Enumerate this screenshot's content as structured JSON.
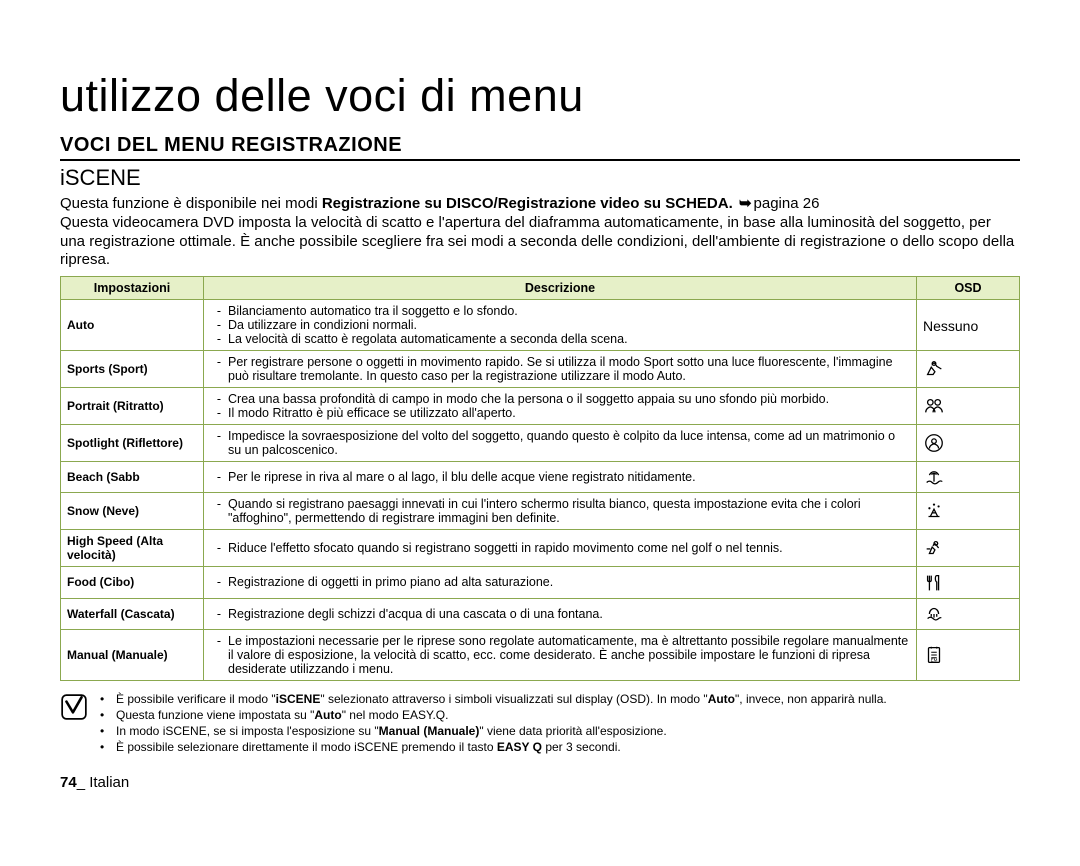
{
  "page": {
    "title": "utilizzo delle voci di menu",
    "section_title": "VOCI DEL MENU REGISTRAZIONE",
    "subheading": "iSCENE",
    "intro_pre": "Questa funzione è disponibile nei modi ",
    "intro_bold": "Registrazione su DISCO/Registrazione video su SCHEDA.",
    "intro_pageref": "pagina 26",
    "intro_body": "Questa videocamera DVD imposta la velocità di scatto e l'apertura del diaframma automaticamente, in base alla luminosità del soggetto, per una registrazione ottimale. È anche possibile scegliere fra sei modi a seconda delle condizioni, dell'ambiente di registrazione o dello scopo della ripresa."
  },
  "table": {
    "headers": {
      "impostazioni": "Impostazioni",
      "descrizione": "Descrizione",
      "osd": "OSD"
    },
    "rows": [
      {
        "setting": "Auto",
        "osd_text": "Nessuno",
        "desc": [
          "Bilanciamento automatico tra il soggetto e lo sfondo.",
          "Da utilizzare in condizioni normali.",
          "La velocità di scatto è regolata automaticamente a seconda della scena."
        ]
      },
      {
        "setting": "Sports (Sport)",
        "osd_icon": "sports",
        "desc": [
          "Per registrare persone o oggetti in movimento rapido. Se si utilizza il modo Sport sotto una luce fluorescente, l'immagine può risultare tremolante. In questo caso per la registrazione utilizzare il modo Auto."
        ]
      },
      {
        "setting": "Portrait (Ritratto)",
        "osd_icon": "portrait",
        "desc": [
          "Crea una bassa profondità di campo in modo che la persona o il soggetto appaia su uno sfondo più morbido.",
          "Il modo Ritratto è più efficace se utilizzato all'aperto."
        ]
      },
      {
        "setting": "Spotlight (Riflettore)",
        "osd_icon": "spotlight",
        "desc": [
          "Impedisce la sovraesposizione del volto del soggetto, quando questo è colpito da luce intensa, come ad un matrimonio o su un palcoscenico."
        ]
      },
      {
        "setting": "Beach (Sabb",
        "osd_icon": "beach",
        "desc": [
          "Per le riprese in riva al mare o al lago, il blu delle acque viene registrato nitidamente."
        ]
      },
      {
        "setting": "Snow (Neve)",
        "osd_icon": "snow",
        "desc": [
          "Quando si registrano paesaggi innevati in cui l'intero schermo risulta bianco, questa impostazione evita che i colori \"affoghino\", permettendo di registrare immagini ben definite."
        ]
      },
      {
        "setting": "High Speed (Alta velocità)",
        "osd_icon": "highspeed",
        "desc": [
          "Riduce l'effetto sfocato quando si registrano soggetti in rapido movimento come nel golf o nel tennis."
        ]
      },
      {
        "setting": "Food (Cibo)",
        "osd_icon": "food",
        "desc": [
          "Registrazione di oggetti in primo piano ad alta saturazione."
        ]
      },
      {
        "setting": "Waterfall (Cascata)",
        "osd_icon": "waterfall",
        "desc": [
          "Registrazione degli schizzi d'acqua di una cascata o di una fontana."
        ]
      },
      {
        "setting": "Manual (Manuale)",
        "osd_icon": "manual",
        "desc": [
          "Le impostazioni necessarie per le riprese sono regolate automaticamente, ma è altrettanto possibile regolare manualmente il valore di esposizione, la velocità di scatto, ecc. come desiderato. È anche possibile impostare le funzioni di ripresa desiderate utilizzando i menu."
        ]
      }
    ]
  },
  "notes": {
    "items": [
      {
        "pre": "È possibile verificare il modo \"",
        "b1": "iSCENE",
        "mid": "\" selezionato attraverso i simboli visualizzati sul display (OSD). In modo \"",
        "b2": "Auto",
        "post": "\", invece, non apparirà nulla."
      },
      {
        "pre": "Questa funzione viene impostata su \"",
        "b1": "Auto",
        "post": "\" nel modo EASY.Q."
      },
      {
        "pre": "In modo iSCENE, se si imposta l'esposizione su \"",
        "b1": "Manual (Manuale)",
        "post": "\" viene data priorità all'esposizione."
      },
      {
        "pre": "È possibile selezionare direttamente il modo iSCENE premendo il tasto ",
        "b1": "EASY Q",
        "post": " per 3 secondi."
      }
    ]
  },
  "footer": {
    "pagenum": "74",
    "sep": "_ ",
    "lang": "Italian"
  }
}
